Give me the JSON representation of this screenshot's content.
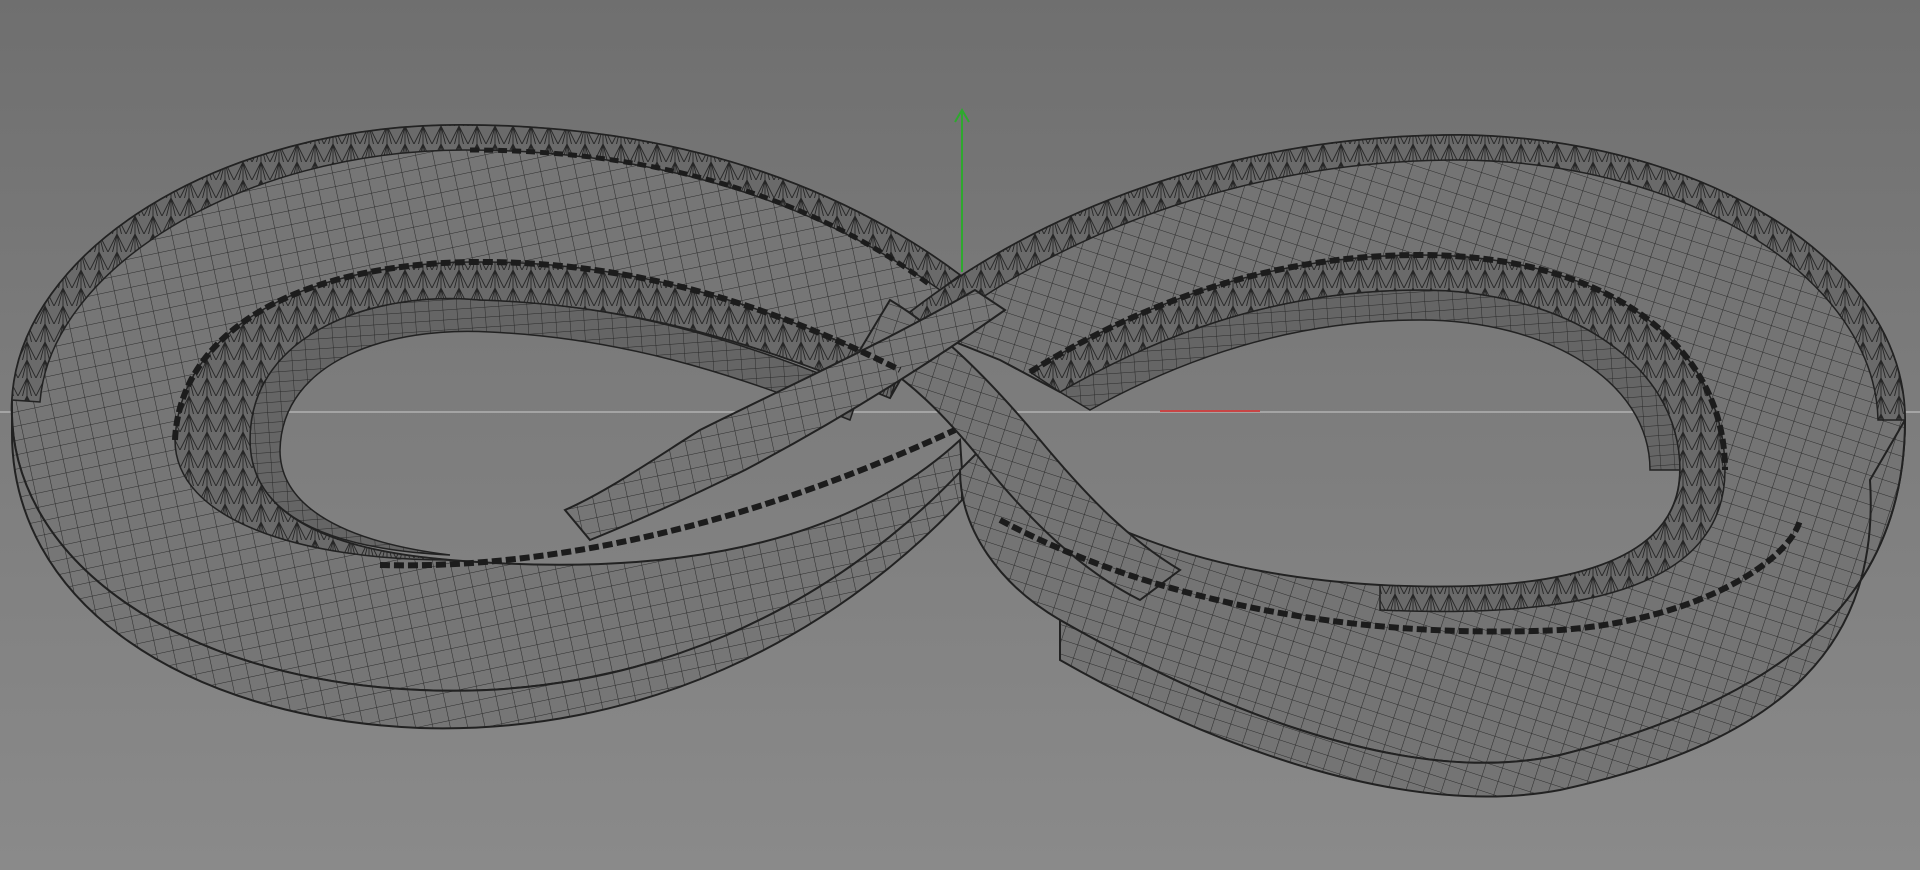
{
  "viewport": {
    "background_top": "#6f6f6f",
    "background_bottom": "#8a8a8a",
    "display_mode": "wireframe-shaded"
  },
  "axes": {
    "y_axis_color": "#2ea82e",
    "x_axis_color": "#c84545",
    "horizon_color": "#c8c8c8"
  },
  "model": {
    "shape": "infinity-loop-ribbon",
    "surface_color": "#747474",
    "edge_color": "#2b2b2b",
    "inner_wall_color": "#5f5f5f"
  }
}
